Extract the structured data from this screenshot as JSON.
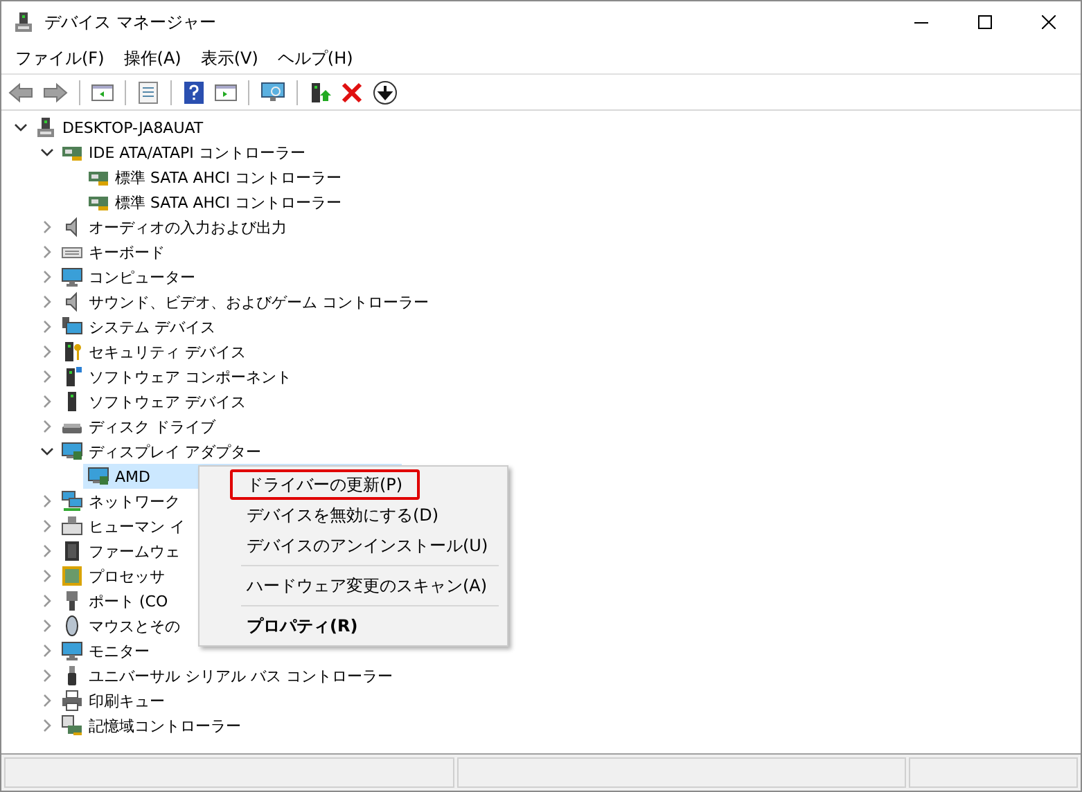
{
  "window": {
    "title": "デバイス マネージャー"
  },
  "menu_bar": [
    "ファイル(F)",
    "操作(A)",
    "表示(V)",
    "ヘルプ(H)"
  ],
  "toolbar": {
    "back_disabled": true,
    "forward_disabled": true
  },
  "tree": [
    {
      "label": "DESKTOP-JA8AUAT",
      "expanded": true,
      "selected": false,
      "children": [
        {
          "label": "IDE ATA/ATAPI コントローラー",
          "expanded": true,
          "selected": false,
          "children": [
            {
              "label": "標準 SATA AHCI コントローラー",
              "selected": false
            },
            {
              "label": "標準 SATA AHCI コントローラー",
              "selected": false
            }
          ]
        },
        {
          "label": "オーディオの入力および出力",
          "expanded": false,
          "selected": false
        },
        {
          "label": "キーボード",
          "expanded": false,
          "selected": false
        },
        {
          "label": "コンピューター",
          "expanded": false,
          "selected": false
        },
        {
          "label": "サウンド、ビデオ、およびゲーム コントローラー",
          "expanded": false,
          "selected": false
        },
        {
          "label": "システム デバイス",
          "expanded": false,
          "selected": false
        },
        {
          "label": "セキュリティ デバイス",
          "expanded": false,
          "selected": false
        },
        {
          "label": "ソフトウェア コンポーネント",
          "expanded": false,
          "selected": false
        },
        {
          "label": "ソフトウェア デバイス",
          "expanded": false,
          "selected": false
        },
        {
          "label": "ディスク ドライブ",
          "expanded": false,
          "selected": false
        },
        {
          "label": "ディスプレイ アダプター",
          "expanded": true,
          "selected": false,
          "children": [
            {
              "label": "AMD",
              "selected": true
            }
          ]
        },
        {
          "label": "ネットワーク",
          "expanded": false,
          "selected": false
        },
        {
          "label": "ヒューマン イ",
          "expanded": false,
          "selected": false
        },
        {
          "label": "ファームウェ",
          "expanded": false,
          "selected": false
        },
        {
          "label": "プロセッサ",
          "expanded": false,
          "selected": false
        },
        {
          "label": "ポート (CO",
          "expanded": false,
          "selected": false
        },
        {
          "label": "マウスとその",
          "expanded": false,
          "selected": false
        },
        {
          "label": "モニター",
          "expanded": false,
          "selected": false
        },
        {
          "label": "ユニバーサル シリアル バス コントローラー",
          "expanded": false,
          "selected": false
        },
        {
          "label": "印刷キュー",
          "expanded": false,
          "selected": false
        },
        {
          "label": "記憶域コントローラー",
          "expanded": false,
          "selected": false
        }
      ]
    }
  ],
  "context_menu": [
    [
      {
        "label": "ドライバーの更新(P)",
        "bold": false,
        "highlighted": true
      },
      {
        "label": "デバイスを無効にする(D)",
        "bold": false,
        "highlighted": false
      },
      {
        "label": "デバイスのアンインストール(U)",
        "bold": false,
        "highlighted": false
      }
    ],
    [
      {
        "label": "ハードウェア変更のスキャン(A)",
        "bold": false,
        "highlighted": false
      }
    ],
    [
      {
        "label": "プロパティ(R)",
        "bold": true,
        "highlighted": false
      }
    ]
  ]
}
